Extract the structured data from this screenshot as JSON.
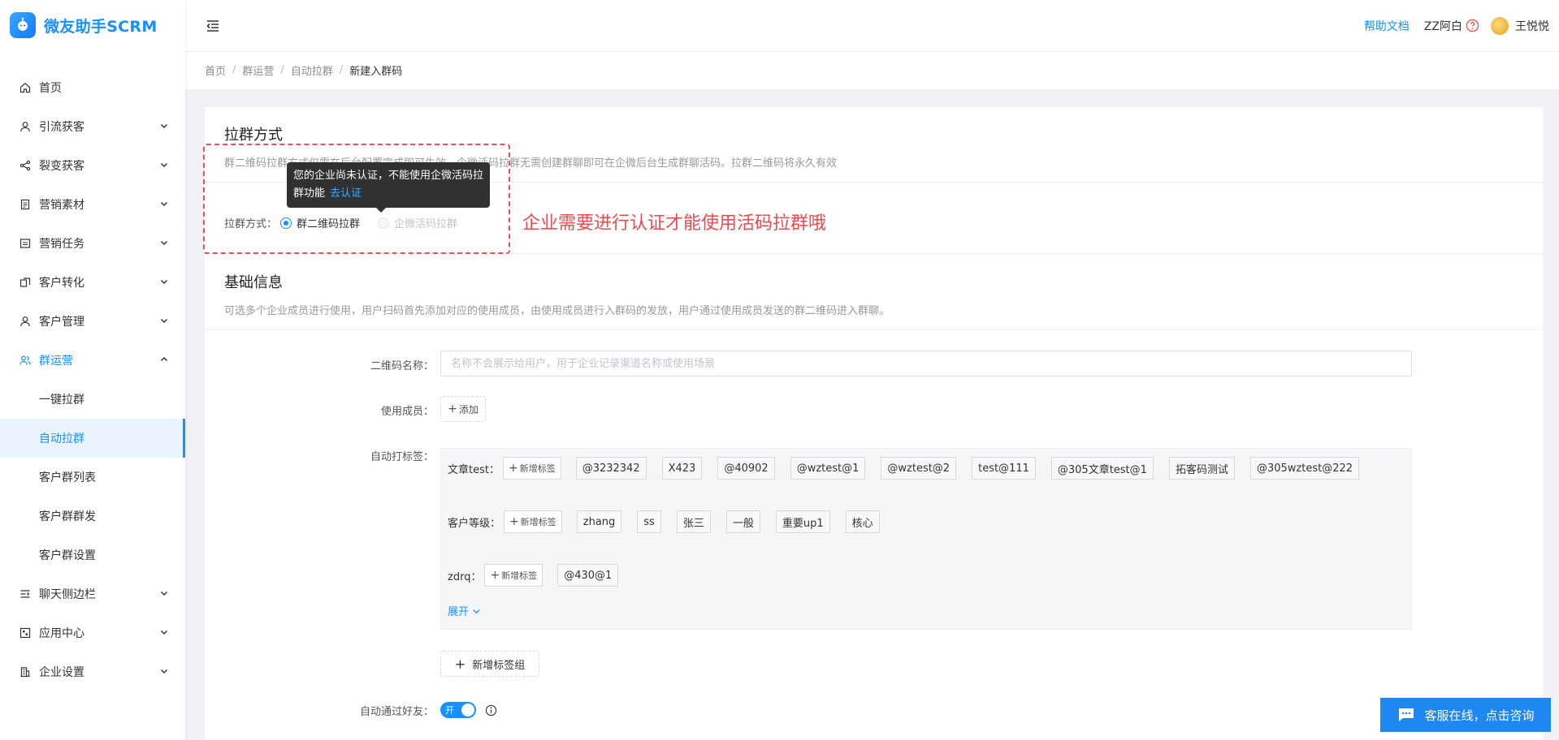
{
  "app": {
    "name": "微友助手SCRM"
  },
  "sidebar": {
    "items": [
      {
        "label": "首页",
        "icon": "home-icon",
        "expandable": false
      },
      {
        "label": "引流获客",
        "icon": "user-icon",
        "expandable": true
      },
      {
        "label": "裂变获客",
        "icon": "share-icon",
        "expandable": true
      },
      {
        "label": "营销素材",
        "icon": "document-icon",
        "expandable": true
      },
      {
        "label": "营销任务",
        "icon": "task-icon",
        "expandable": true
      },
      {
        "label": "客户转化",
        "icon": "convert-icon",
        "expandable": true
      },
      {
        "label": "客户管理",
        "icon": "user-icon",
        "expandable": true
      },
      {
        "label": "群运营",
        "icon": "group-icon",
        "expandable": true,
        "expanded": true
      }
    ],
    "sub_items": [
      "一键拉群",
      "自动拉群",
      "客户群列表",
      "客户群群发",
      "客户群设置"
    ],
    "active_sub": "自动拉群",
    "bottom_items": [
      {
        "label": "聊天侧边栏",
        "icon": "sidebar-icon"
      },
      {
        "label": "应用中心",
        "icon": "apps-icon"
      },
      {
        "label": "企业设置",
        "icon": "building-icon"
      }
    ]
  },
  "header": {
    "help_label": "帮助文档",
    "corp_name": "ZZ阿白",
    "user_name": "王悦悦"
  },
  "breadcrumb": [
    "首页",
    "群运营",
    "自动拉群",
    "新建入群码"
  ],
  "section1": {
    "title": "拉群方式",
    "desc": "群二维码拉群方式仅需在后台配置完成即可生效，企微活码拉群无需创建群聊即可在企微后台生成群聊活码。拉群二维码将永久有效",
    "label": "拉群方式：",
    "option1": "群二维码拉群",
    "option2": "企微活码拉群"
  },
  "tooltip": {
    "text": "您的企业尚未认证，不能使用企微活码拉群功能",
    "link": "去认证"
  },
  "annotation": "企业需要进行认证才能使用活码拉群哦",
  "section2": {
    "title": "基础信息",
    "desc": "可选多个企业成员进行使用，用户扫码首先添加对应的使用成员，由使用成员进行入群码的发放，用户通过使用成员发送的群二维码进入群聊。"
  },
  "form": {
    "qr_name_label": "二维码名称：",
    "qr_name_placeholder": "名称不会展示给用户，用于企业记录渠道名称或使用场景",
    "members_label": "使用成员：",
    "add_label": "添加",
    "auto_tag_label": "自动打标签：",
    "new_tag_label": "新增标签",
    "tag_groups": [
      {
        "name": "文章test：",
        "tags": [
          "@3232342",
          "X423",
          "@40902",
          "@wztest@1",
          "@wztest@2",
          "test@111",
          "@305文章test@1",
          "拓客码测试",
          "@305wztest@222"
        ]
      },
      {
        "name": "客户等级：",
        "tags": [
          "zhang",
          "ss",
          "张三",
          "一般",
          "重要up1",
          "核心"
        ]
      },
      {
        "name": "zdrq：",
        "tags": [
          "@430@1"
        ]
      }
    ],
    "expand_label": "展开",
    "add_group_label": "新增标签组",
    "auto_pass_label": "自动通过好友：",
    "switch_on_text": "开"
  },
  "float_cs": {
    "label": "客服在线，点击咨询"
  },
  "colors": {
    "primary": "#1890ff",
    "annotation": "#f0494f"
  }
}
